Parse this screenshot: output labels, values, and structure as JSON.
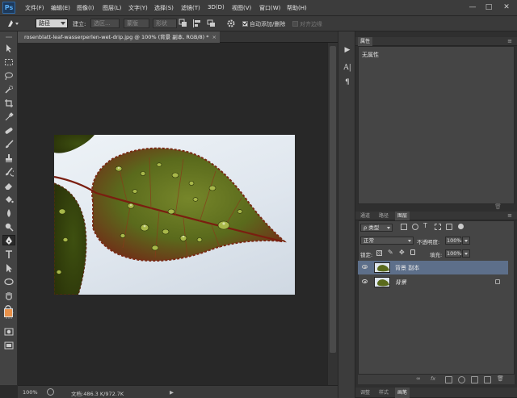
{
  "app": {
    "logo": "Ps",
    "menu": [
      "文件(F)",
      "编辑(E)",
      "图像(I)",
      "图层(L)",
      "文字(Y)",
      "选择(S)",
      "滤镜(T)",
      "3D(D)",
      "视图(V)",
      "窗口(W)",
      "帮助(H)"
    ],
    "window_buttons": {
      "minimize": "—",
      "restore": "□",
      "close": "✕"
    }
  },
  "options_bar": {
    "mode_select": "路径",
    "make_label": "建立:",
    "selection_button": "选区...",
    "mask_button": "蒙版",
    "shape_button": "形状",
    "auto_add_delete": "自动添加/删除",
    "auto_add_delete_checked": true,
    "align_edges": "对齐边缘",
    "align_edges_checked": false
  },
  "document": {
    "tab_title": "rosenblatt-leaf-wasserperlen-wet-drip.jpg @ 100% (背景 副本, RGB/8) *",
    "close_glyph": "×"
  },
  "status": {
    "zoom": "100%",
    "doc_info": "文档:486.3 K/972.7K"
  },
  "properties_panel": {
    "tab": "属性",
    "content": "无属性"
  },
  "layers_panel": {
    "tabs": [
      "通道",
      "路径",
      "图层"
    ],
    "active_tab": "图层",
    "filter_kind": "类型",
    "blend_mode": "正常",
    "opacity_label": "不透明度:",
    "opacity_value": "100%",
    "lock_label": "锁定:",
    "fill_label": "填充:",
    "fill_value": "100%",
    "layers": [
      {
        "name": "背景 副本",
        "selected": true,
        "locked": false
      },
      {
        "name": "背景",
        "selected": false,
        "locked": true
      }
    ]
  },
  "bottom_tabs": [
    "调整",
    "样式",
    "画笔"
  ],
  "bottom_active": "画笔",
  "colors": {
    "foreground": "#e8914a",
    "background": "#f0a060",
    "selection": "#5d6f8a",
    "leaf_dark": "#3c4a12",
    "leaf_light": "#6a7a22",
    "leaf_edge": "#7a2a14"
  }
}
